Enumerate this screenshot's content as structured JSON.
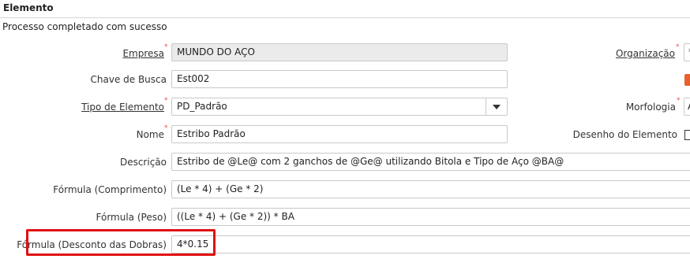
{
  "header": {
    "title": "Elemento",
    "status_message": "Processo completado com sucesso"
  },
  "fields": {
    "empresa": {
      "label": "Empresa",
      "value": "MUNDO DO AÇO",
      "required": true
    },
    "chave_busca": {
      "label": "Chave de Busca",
      "value": "Est002"
    },
    "tipo_elemento": {
      "label": "Tipo de Elemento",
      "value": "PD_Padrão",
      "required": true
    },
    "nome": {
      "label": "Nome",
      "value": "Estribo Padrão",
      "required": true
    },
    "descricao": {
      "label": "Descrição",
      "value": "Estribo de @Le@ com 2 ganchos de @Ge@ utilizando Bitola e Tipo de Aço @BA@"
    },
    "formula_comprimento": {
      "label": "Fórmula (Comprimento)",
      "value": "(Le * 4) + (Ge * 2)"
    },
    "formula_peso": {
      "label": "Fórmula (Peso)",
      "value": "((Le * 4) + (Ge * 2)) * BA"
    },
    "formula_desconto": {
      "label": "Fórmula (Desconto das Dobras)",
      "value": "4*0.15"
    }
  },
  "right_fields": {
    "organizacao": {
      "label": "Organização",
      "value": "*",
      "required": true
    },
    "morfologia": {
      "label": "Morfologia",
      "value": "A",
      "required": true
    },
    "desenho_elemento": {
      "label": "Desenho do Elemento"
    }
  },
  "icons": {
    "orange_icon": "orange-action-icon",
    "dropdown": "chevron-down-icon",
    "accent_color": "#e8612c",
    "highlight_color": "#e01010"
  }
}
